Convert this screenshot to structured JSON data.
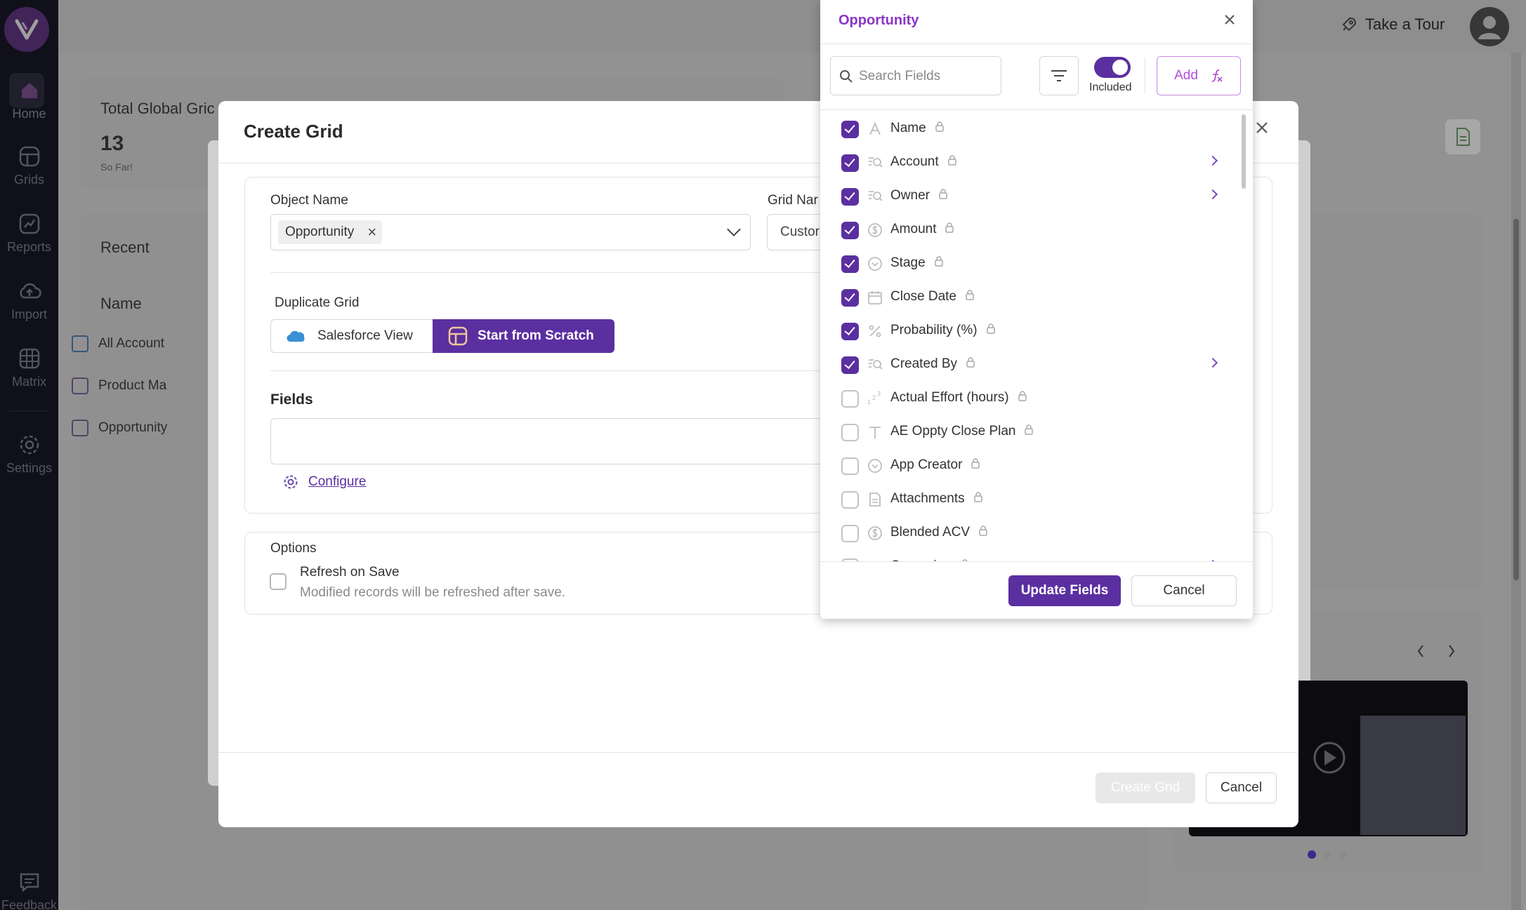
{
  "sidebar": {
    "items": [
      {
        "label": "Home",
        "icon": "home-icon"
      },
      {
        "label": "Grids",
        "icon": "grid-icon"
      },
      {
        "label": "Reports",
        "icon": "report-icon"
      },
      {
        "label": "Import",
        "icon": "upload-cloud-icon"
      },
      {
        "label": "Matrix",
        "icon": "matrix-icon"
      },
      {
        "label": "Settings",
        "icon": "gear-icon"
      },
      {
        "label": "Feedback",
        "icon": "feedback-icon"
      }
    ]
  },
  "header": {
    "tour_label": "Take a Tour"
  },
  "background": {
    "stat_title": "Total Global Gric",
    "stat_value": "13",
    "stat_sub": "So Far!",
    "recent_title": "Recent",
    "name_header": "Name",
    "recent_items": [
      "All Account",
      "Product Ma",
      "Opportunity"
    ]
  },
  "modal": {
    "title": "Create Grid",
    "object_name_label": "Object Name",
    "object_name_value": "Opportunity",
    "grid_name_label": "Grid Nar",
    "grid_name_value": "Custor",
    "duplicate_label": "Duplicate Grid",
    "salesforce_view": "Salesforce View",
    "start_scratch": "Start from Scratch",
    "fields_label": "Fields",
    "configure_label": "Configure",
    "options_label": "Options",
    "refresh_label": "Refresh on Save",
    "refresh_desc": "Modified records will be refreshed after save.",
    "create_button": "Create Grid",
    "cancel_button": "Cancel"
  },
  "panel": {
    "title": "Opportunity",
    "search_placeholder": "Search Fields",
    "toggle_label": "Included",
    "add_label": "Add",
    "fields": [
      {
        "name": "Name",
        "checked": true,
        "icon": "text-a-icon",
        "arrow": false
      },
      {
        "name": "Account",
        "checked": true,
        "icon": "lookup-icon",
        "arrow": true
      },
      {
        "name": "Owner",
        "checked": true,
        "icon": "lookup-icon",
        "arrow": true
      },
      {
        "name": "Amount",
        "checked": true,
        "icon": "currency-icon",
        "arrow": false
      },
      {
        "name": "Stage",
        "checked": true,
        "icon": "picklist-icon",
        "arrow": false
      },
      {
        "name": "Close Date",
        "checked": true,
        "icon": "calendar-icon",
        "arrow": false
      },
      {
        "name": "Probability (%)",
        "checked": true,
        "icon": "percent-icon",
        "arrow": false
      },
      {
        "name": "Created By",
        "checked": true,
        "icon": "lookup-icon",
        "arrow": true
      },
      {
        "name": "Actual Effort (hours)",
        "checked": false,
        "icon": "number-icon",
        "arrow": false
      },
      {
        "name": "AE Oppty Close Plan",
        "checked": false,
        "icon": "text-t-icon",
        "arrow": false
      },
      {
        "name": "App Creator",
        "checked": false,
        "icon": "picklist-icon",
        "arrow": false
      },
      {
        "name": "Attachments",
        "checked": false,
        "icon": "document-icon",
        "arrow": false
      },
      {
        "name": "Blended ACV",
        "checked": false,
        "icon": "currency-icon",
        "arrow": false
      },
      {
        "name": "Campaign",
        "checked": false,
        "icon": "lookup-icon",
        "arrow": true
      }
    ],
    "update_button": "Update Fields",
    "cancel_button": "Cancel"
  }
}
